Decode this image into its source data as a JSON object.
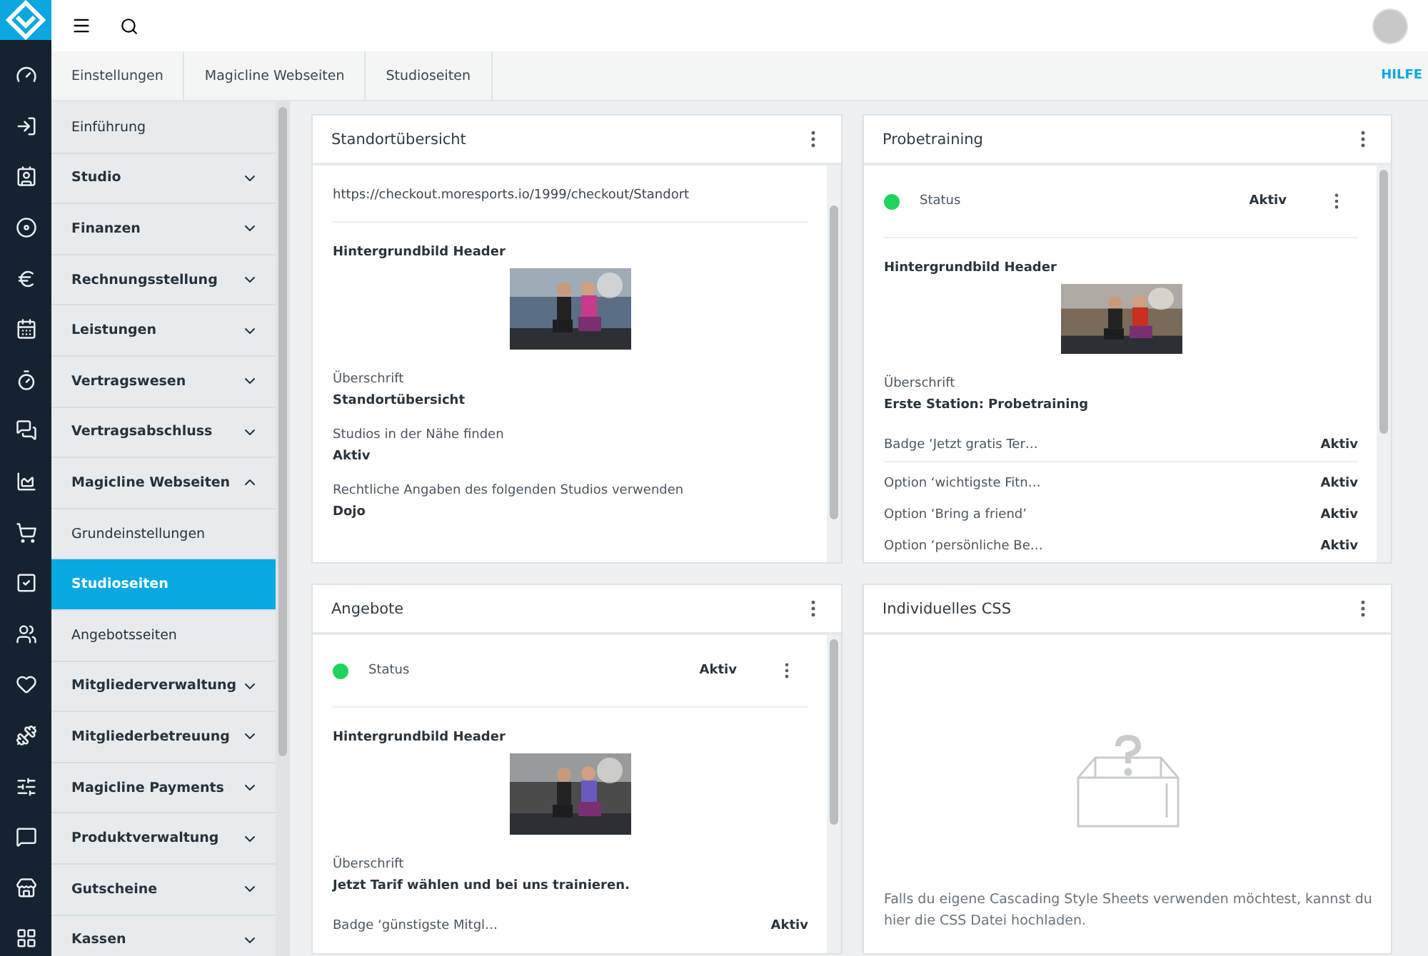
{
  "topbar": {
    "help": "HILFE"
  },
  "breadcrumbs": [
    "Einstellungen",
    "Magicline Webseiten",
    "Studioseiten"
  ],
  "sidebar": {
    "items": [
      {
        "label": "Einführung",
        "kind": "link",
        "selected": false
      },
      {
        "label": "Studio",
        "kind": "group",
        "expanded": false,
        "selected": false
      },
      {
        "label": "Finanzen",
        "kind": "group",
        "expanded": false,
        "selected": false
      },
      {
        "label": "Rechnungsstellung",
        "kind": "group",
        "expanded": false,
        "selected": false
      },
      {
        "label": "Leistungen",
        "kind": "group",
        "expanded": false,
        "selected": false
      },
      {
        "label": "Vertragswesen",
        "kind": "group",
        "expanded": false,
        "selected": false
      },
      {
        "label": "Vertragsabschluss",
        "kind": "group",
        "expanded": false,
        "selected": false
      },
      {
        "label": "Magicline Webseiten",
        "kind": "group",
        "expanded": true,
        "selected": false
      },
      {
        "label": "Grundeinstellungen",
        "kind": "link",
        "selected": false
      },
      {
        "label": "Studioseiten",
        "kind": "link",
        "selected": true
      },
      {
        "label": "Angebotsseiten",
        "kind": "link",
        "selected": false
      },
      {
        "label": "Mitgliederverwaltung",
        "kind": "group",
        "expanded": false,
        "selected": false
      },
      {
        "label": "Mitgliederbetreuung",
        "kind": "group",
        "expanded": false,
        "selected": false
      },
      {
        "label": "Magicline Payments",
        "kind": "group",
        "expanded": false,
        "selected": false
      },
      {
        "label": "Produktverwaltung",
        "kind": "group",
        "expanded": false,
        "selected": false
      },
      {
        "label": "Gutscheine",
        "kind": "group",
        "expanded": false,
        "selected": false
      },
      {
        "label": "Kassen",
        "kind": "group",
        "expanded": false,
        "selected": false
      }
    ]
  },
  "cards": [
    {
      "title": "Standortübersicht",
      "items": [
        {
          "kind": "text",
          "text": "https://checkout.moresports.io/1999/checkout/Standort"
        },
        {
          "kind": "divider"
        },
        {
          "label": "Hintergrundbild Header"
        },
        {
          "kind": "field",
          "label": "Überschrift",
          "value": "Standortübersicht"
        },
        {
          "kind": "field",
          "label": "Studios in der Nähe finden",
          "value": "Aktiv"
        },
        {
          "kind": "field",
          "label": "Rechtliche Angaben des folgenden Studios verwenden",
          "value": "Dojo"
        }
      ]
    },
    {
      "title": "Probetraining",
      "items": [
        {
          "kind": "status",
          "label": "Status",
          "value": "Aktiv",
          "color": "#1fd45a"
        },
        {
          "kind": "divider"
        },
        {
          "label": "Hintergrundbild Header"
        },
        {
          "kind": "field",
          "label": "Überschrift",
          "value": "Erste Station: Probetraining"
        },
        {
          "kind": "toggle",
          "label": "Badge ‘Jetzt gratis Ter…",
          "value": "Aktiv"
        },
        {
          "kind": "divider"
        },
        {
          "kind": "toggle",
          "label": "Option ‘wichtigste Fitn…",
          "value": "Aktiv"
        },
        {
          "kind": "toggle",
          "label": "Option ‘Bring a friend’",
          "value": "Aktiv"
        },
        {
          "kind": "toggle",
          "label": "Option ‘persönliche Be…",
          "value": "Aktiv"
        }
      ]
    },
    {
      "title": "Angebote",
      "items": [
        {
          "kind": "status",
          "label": "Status",
          "value": "Aktiv",
          "color": "#1fd45a"
        },
        {
          "kind": "divider"
        },
        {
          "label": "Hintergrundbild Header"
        },
        {
          "kind": "field",
          "label": "Überschrift",
          "value": "Jetzt Tarif wählen und bei uns trainieren."
        },
        {
          "kind": "toggle",
          "label": "Badge ‘günstigste Mitgl…",
          "value": "Aktiv"
        }
      ]
    },
    {
      "title": "Individuelles CSS",
      "items": [
        {
          "kind": "empty",
          "text": "Falls du eigene Cascading Style Sheets verwenden möchtest, kannst du hier die CSS Datei hochladen."
        }
      ]
    }
  ]
}
